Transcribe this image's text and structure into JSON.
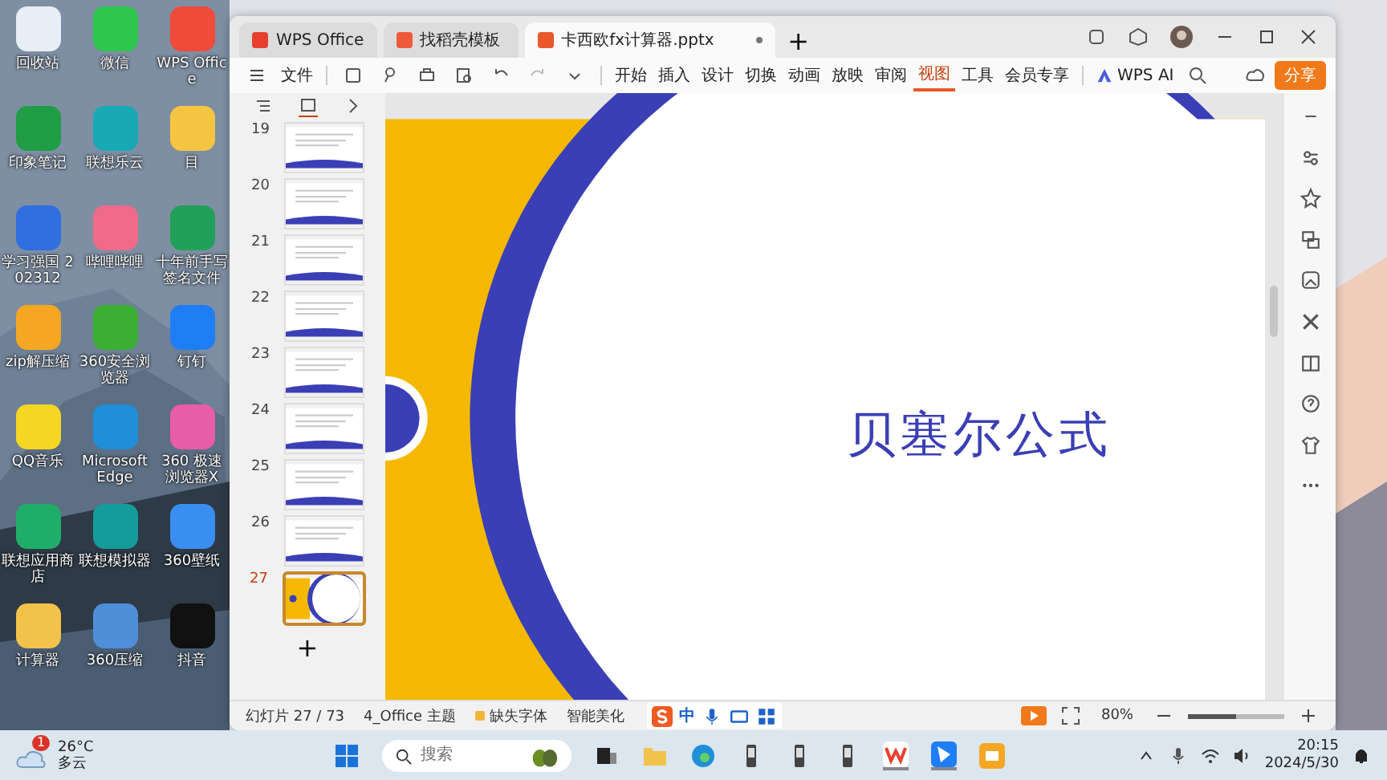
{
  "desktop": {
    "icons": [
      {
        "label": "回收站",
        "color": "#e8eef5"
      },
      {
        "label": "微信",
        "color": "#2dc84d"
      },
      {
        "label": "WPS Office",
        "color": "#f04a3a"
      },
      {
        "label": "印象笔记",
        "color": "#1f9e45"
      },
      {
        "label": "联想乐云",
        "color": "#19a9b5"
      },
      {
        "label": "目",
        "color": "#f5c542"
      },
      {
        "label": "学习强国 202312",
        "color": "#2f6fe0"
      },
      {
        "label": "哔哩哔哩",
        "color": "#f06a8a"
      },
      {
        "label": "十年前手写签名文件",
        "color": "#22a05a"
      },
      {
        "label": "zip解压缩",
        "color": "#f5a623"
      },
      {
        "label": "360安全浏览器",
        "color": "#3cb034"
      },
      {
        "label": "钉钉",
        "color": "#1f7ef5"
      },
      {
        "label": "QQ音乐",
        "color": "#f5d623"
      },
      {
        "label": "Microsoft Edge",
        "color": "#1e8fd8"
      },
      {
        "label": "360 极速浏览器X",
        "color": "#e85da8"
      },
      {
        "label": "联想应用商店",
        "color": "#1fae6a"
      },
      {
        "label": "联想模拟器",
        "color": "#139c9a"
      },
      {
        "label": "360壁纸",
        "color": "#3a8ef0"
      },
      {
        "label": "计算器",
        "color": "#f2c24a"
      },
      {
        "label": "360压缩",
        "color": "#4f8ed8"
      },
      {
        "label": "抖音",
        "color": "#111111"
      }
    ]
  },
  "window": {
    "tabs": [
      {
        "label": "WPS Office",
        "selected": false,
        "color": "#e8402e"
      },
      {
        "label": "找稻壳模板",
        "selected": false,
        "color": "#ef5b3a"
      },
      {
        "label": "卡西欧fx计算器.pptx",
        "selected": true,
        "color": "#e8582a"
      }
    ],
    "new_tab": "+",
    "file_menu": "文件",
    "ribbon_tabs": [
      {
        "label": "开始",
        "selected": false
      },
      {
        "label": "插入",
        "selected": false
      },
      {
        "label": "设计",
        "selected": false
      },
      {
        "label": "切换",
        "selected": false
      },
      {
        "label": "动画",
        "selected": false
      },
      {
        "label": "放映",
        "selected": false
      },
      {
        "label": "审阅",
        "selected": false
      },
      {
        "label": "视图",
        "selected": true
      },
      {
        "label": "工具",
        "selected": false
      },
      {
        "label": "会员专享",
        "selected": false
      }
    ],
    "ai_label": "WPS AI",
    "share_button": "分享"
  },
  "thumbnails": [
    {
      "number": "19",
      "selected": false
    },
    {
      "number": "20",
      "selected": false
    },
    {
      "number": "21",
      "selected": false
    },
    {
      "number": "22",
      "selected": false
    },
    {
      "number": "23",
      "selected": false
    },
    {
      "number": "24",
      "selected": false
    },
    {
      "number": "25",
      "selected": false
    },
    {
      "number": "26",
      "selected": false
    },
    {
      "number": "27",
      "selected": true
    }
  ],
  "add_slide": "+",
  "slide": {
    "title": "贝塞尔公式"
  },
  "status_bar": {
    "slide_counter": "幻灯片 27 / 73",
    "theme": "4_Office 主题",
    "missing_fonts": "缺失字体",
    "beautify": "智能美化",
    "ime_label": "中",
    "zoom": "80%",
    "zoom_slider": {
      "level": 0.5
    }
  },
  "taskbar": {
    "weather_badge": "1",
    "temperature": "26°C",
    "weather": "多云",
    "search_placeholder": "搜索",
    "time": "20:15",
    "date": "2024/5/30"
  }
}
